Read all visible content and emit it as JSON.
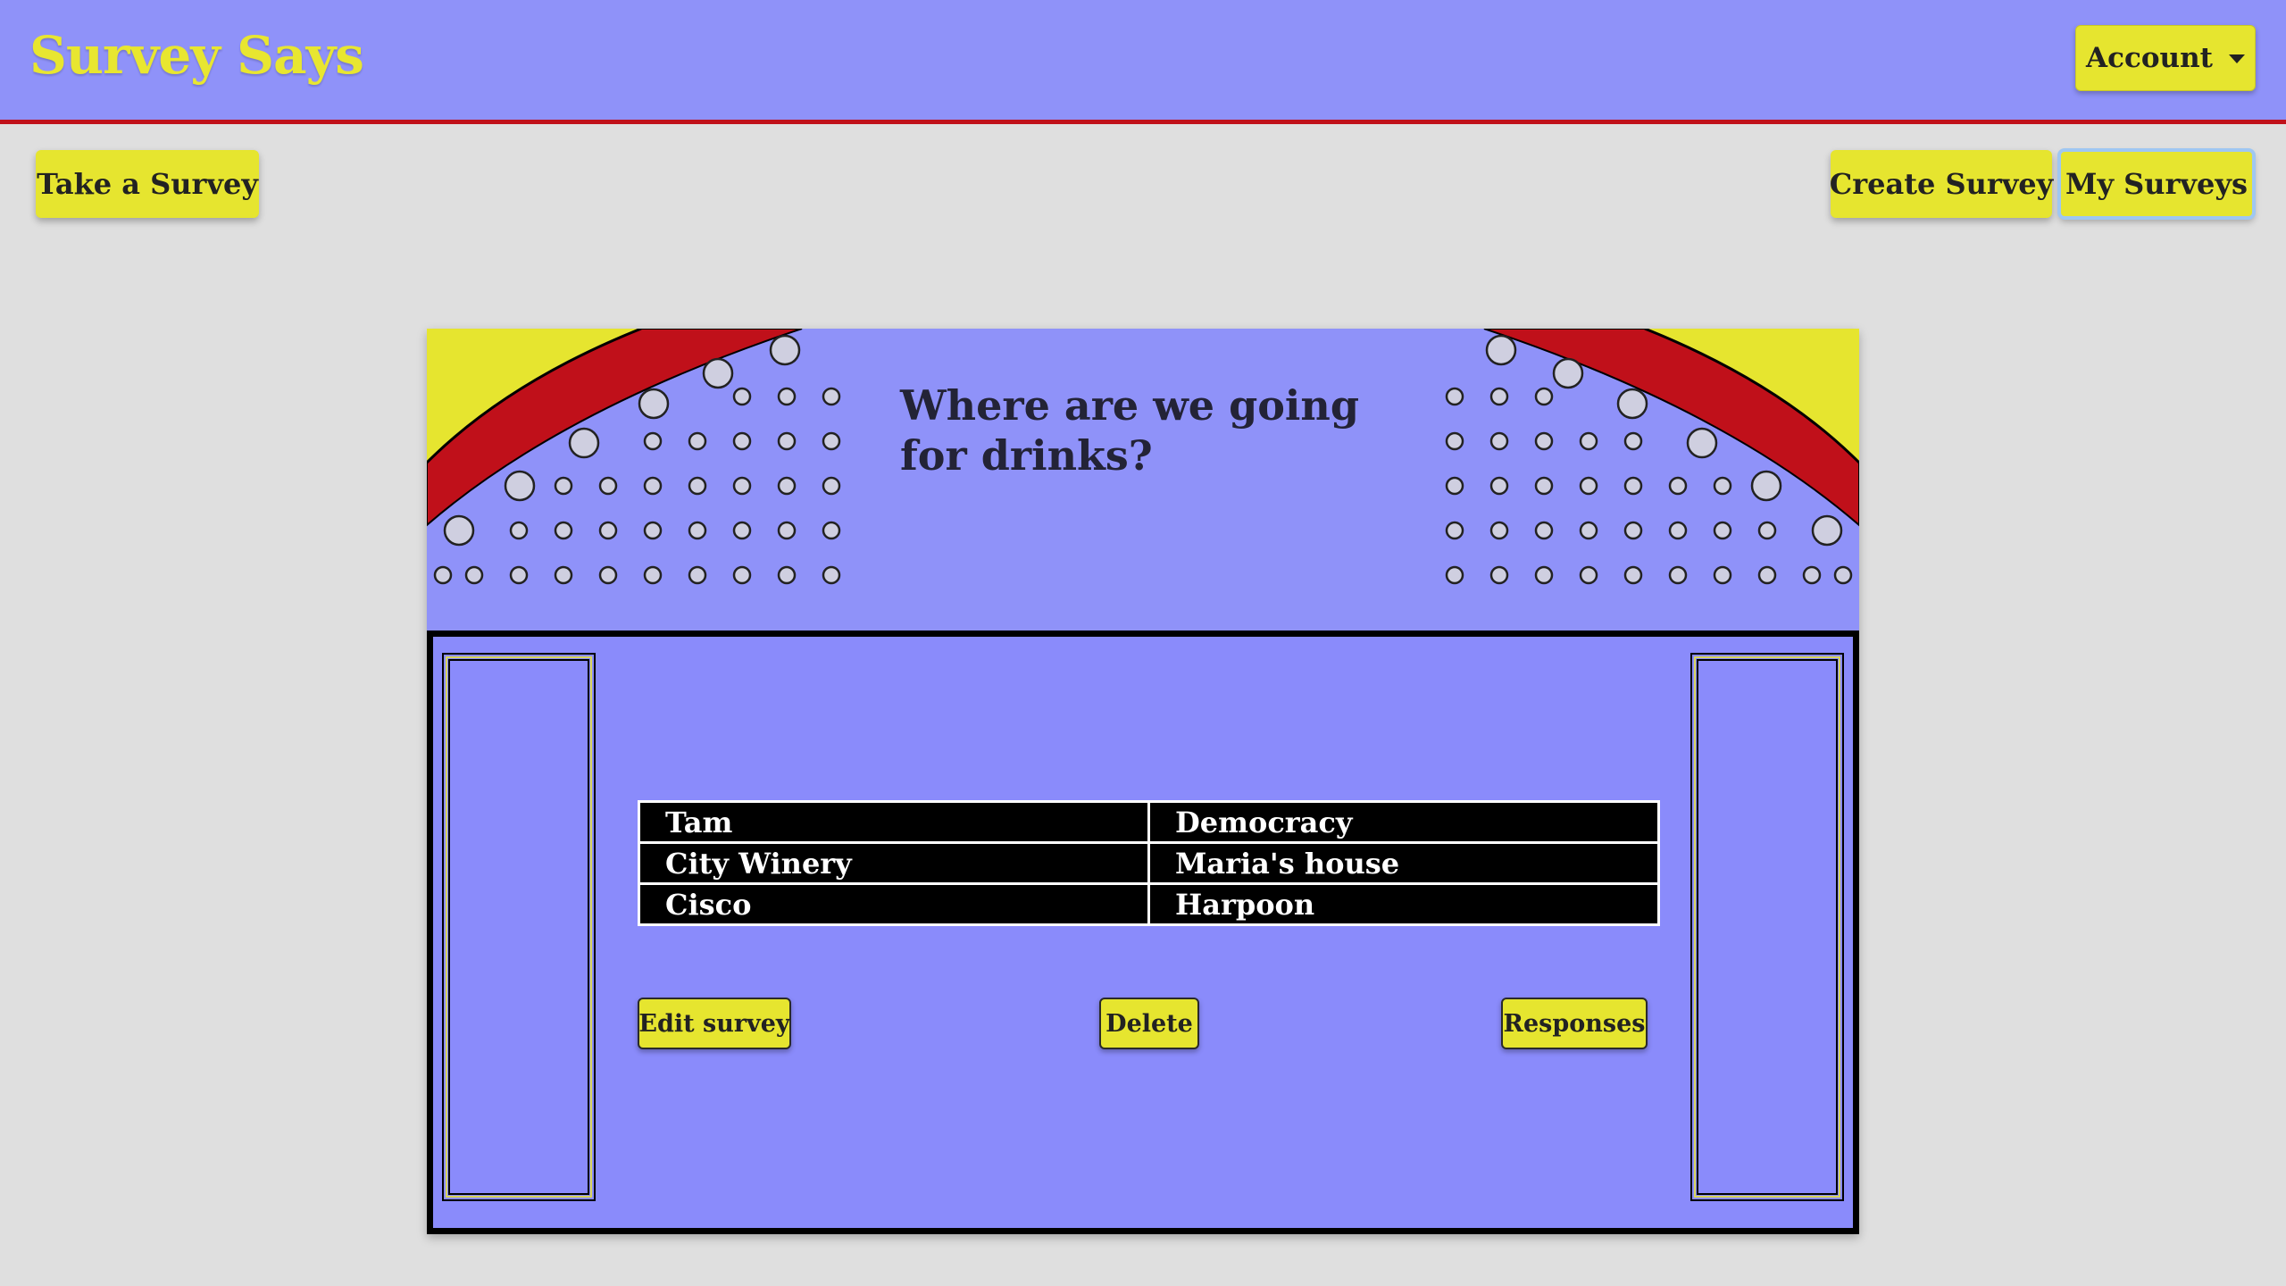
{
  "header": {
    "brand": "Survey Says",
    "account_label": "Account"
  },
  "nav": {
    "take_survey": "Take a Survey",
    "create_survey": "Create Survey",
    "my_surveys": "My Surveys"
  },
  "survey": {
    "question": "Where are we going for drinks?",
    "answers": [
      [
        "Tam",
        "Democracy"
      ],
      [
        "City Winery",
        "Maria's house"
      ],
      [
        "Cisco",
        "Harpoon"
      ]
    ],
    "actions": {
      "edit": "Edit survey",
      "delete": "Delete",
      "responses": "Responses"
    }
  },
  "colors": {
    "header_bg": "#8f92f9",
    "header_rule": "#c0101a",
    "brand_yellow": "#e8e630",
    "button_yellow": "#e6e52f",
    "board_red": "#c0101a",
    "board_blue": "#8a8bfb",
    "page_bg": "#dfdfdf"
  }
}
